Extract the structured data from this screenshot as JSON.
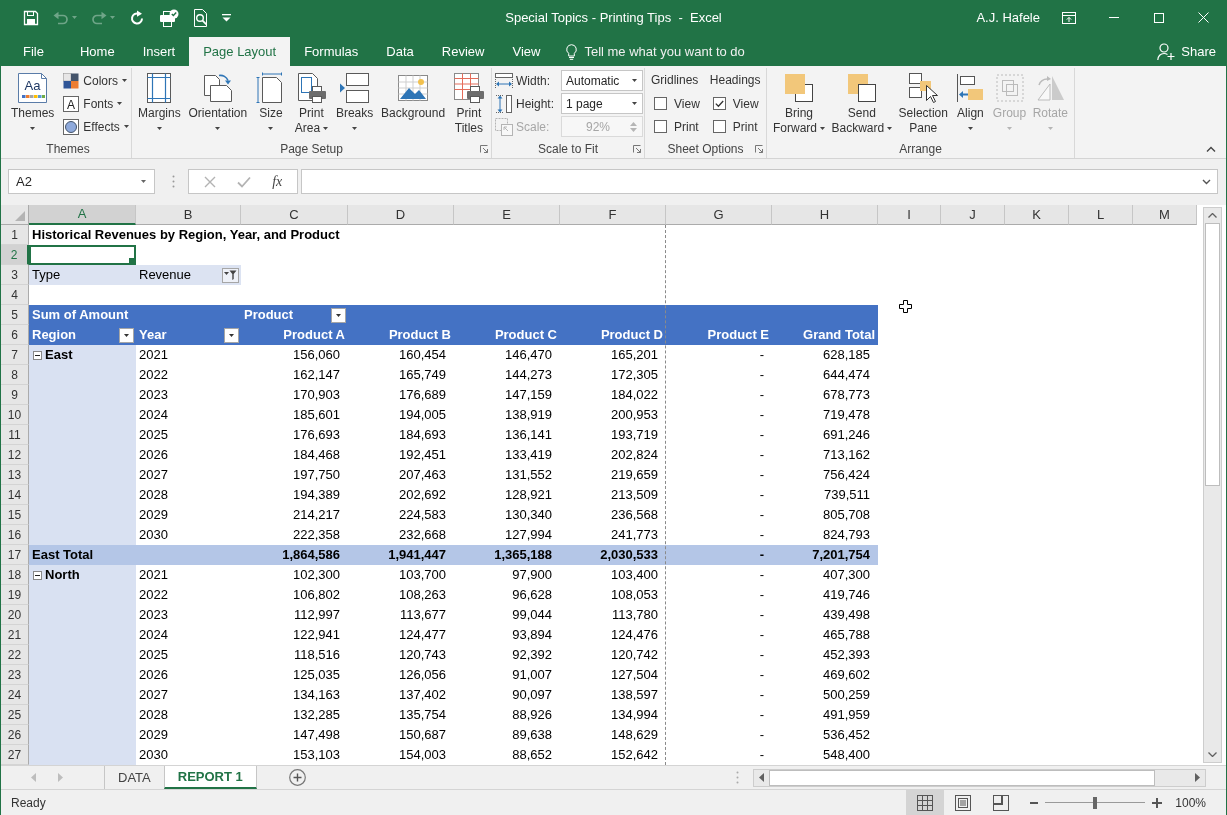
{
  "window": {
    "title": "Special Topics - Printing Tips  -  Excel",
    "user": "A.J. Hafele"
  },
  "quick_access": [
    {
      "disabled": false
    },
    {
      "disabled": true
    },
    {
      "disabled": true
    },
    {
      "disabled": false
    },
    {
      "disabled": false
    },
    {
      "disabled": false
    },
    {
      "disabled": false
    }
  ],
  "ribbon_tabs": [
    {
      "label": "File",
      "selected": false
    },
    {
      "label": "Home",
      "selected": false
    },
    {
      "label": "Insert",
      "selected": false
    },
    {
      "label": "Page Layout",
      "selected": true
    },
    {
      "label": "Formulas",
      "selected": false
    },
    {
      "label": "Data",
      "selected": false
    },
    {
      "label": "Review",
      "selected": false
    },
    {
      "label": "View",
      "selected": false
    }
  ],
  "tell_me": "Tell me what you want to do",
  "share": "Share",
  "ribbon_groups": [
    {
      "label": "Themes",
      "launcher": false,
      "items": [
        {
          "kind": "large",
          "label": "Themes",
          "glyph": "Aa",
          "dropdown": true
        },
        {
          "kind": "small",
          "label": "Colors",
          "dropdown": true
        },
        {
          "kind": "small",
          "label": "Fonts",
          "glyph": "A",
          "dropdown": true
        },
        {
          "kind": "small",
          "label": "Effects",
          "dropdown": true
        }
      ]
    },
    {
      "label": "Page Setup",
      "launcher": true,
      "items": [
        {
          "kind": "large",
          "label": "Margins",
          "dropdown": true
        },
        {
          "kind": "large",
          "label": "Orientation",
          "dropdown": true
        },
        {
          "kind": "large",
          "label": "Size",
          "dropdown": true
        },
        {
          "kind": "large",
          "label": "Print Area",
          "dropdown": true
        },
        {
          "kind": "large",
          "label": "Breaks",
          "dropdown": true
        },
        {
          "kind": "large",
          "label": "Background",
          "dropdown": false
        },
        {
          "kind": "large",
          "label": "Print Titles",
          "dropdown": false
        }
      ]
    },
    {
      "label": "Scale to Fit",
      "launcher": true,
      "items": [
        {
          "kind": "field",
          "label": "Width:",
          "value": "Automatic",
          "disabled": false
        },
        {
          "kind": "field",
          "label": "Height:",
          "value": "1 page",
          "disabled": false
        },
        {
          "kind": "spinner",
          "label": "Scale:",
          "value": "92%",
          "disabled": true
        }
      ]
    },
    {
      "label": "Sheet Options",
      "launcher": true,
      "items": [
        {
          "kind": "checks",
          "label": "Gridlines",
          "options": [
            {
              "label": "View",
              "checked": false
            },
            {
              "label": "Print",
              "checked": false
            }
          ]
        },
        {
          "kind": "checks",
          "label": "Headings",
          "options": [
            {
              "label": "View",
              "checked": true
            },
            {
              "label": "Print",
              "checked": false
            }
          ]
        }
      ]
    },
    {
      "label": "Arrange",
      "launcher": false,
      "items": [
        {
          "kind": "large",
          "label": "Bring Forward",
          "dropdown": true,
          "disabled": false
        },
        {
          "kind": "large",
          "label": "Send Backward",
          "dropdown": true,
          "disabled": false
        },
        {
          "kind": "large",
          "label": "Selection Pane",
          "dropdown": false,
          "disabled": false
        },
        {
          "kind": "large",
          "label": "Align",
          "dropdown": true,
          "disabled": false
        },
        {
          "kind": "large",
          "label": "Group",
          "dropdown": true,
          "disabled": true
        },
        {
          "kind": "large",
          "label": "Rotate",
          "dropdown": true,
          "disabled": true
        }
      ]
    }
  ],
  "formula_bar": {
    "name_box": "A2",
    "function_label": "fx"
  },
  "sheet": {
    "columns": [
      {
        "label": "A",
        "selected": true,
        "page_break_after": false
      },
      {
        "label": "B",
        "selected": false,
        "page_break_after": false
      },
      {
        "label": "C",
        "selected": false,
        "page_break_after": false
      },
      {
        "label": "D",
        "selected": false,
        "page_break_after": false
      },
      {
        "label": "E",
        "selected": false,
        "page_break_after": false
      },
      {
        "label": "F",
        "selected": false,
        "page_break_after": true
      },
      {
        "label": "G",
        "selected": false,
        "page_break_after": false
      },
      {
        "label": "H",
        "selected": false,
        "page_break_after": false
      },
      {
        "label": "I",
        "selected": false,
        "page_break_after": false
      },
      {
        "label": "J",
        "selected": false,
        "page_break_after": false
      },
      {
        "label": "K",
        "selected": false,
        "page_break_after": false
      },
      {
        "label": "L",
        "selected": false,
        "page_break_after": false
      },
      {
        "label": "M",
        "selected": false,
        "page_break_after": false
      }
    ],
    "rows": [
      {
        "label": "1",
        "selected": false
      },
      {
        "label": "2",
        "selected": true
      },
      {
        "label": "3",
        "selected": false
      },
      {
        "label": "4",
        "selected": false
      },
      {
        "label": "5",
        "selected": false
      },
      {
        "label": "6",
        "selected": false
      },
      {
        "label": "7",
        "selected": false
      },
      {
        "label": "8",
        "selected": false
      },
      {
        "label": "9",
        "selected": false
      },
      {
        "label": "10",
        "selected": false
      },
      {
        "label": "11",
        "selected": false
      },
      {
        "label": "12",
        "selected": false
      },
      {
        "label": "13",
        "selected": false
      },
      {
        "label": "14",
        "selected": false
      },
      {
        "label": "15",
        "selected": false
      },
      {
        "label": "16",
        "selected": false
      },
      {
        "label": "17",
        "selected": false
      },
      {
        "label": "18",
        "selected": false
      },
      {
        "label": "19",
        "selected": false
      },
      {
        "label": "20",
        "selected": false
      },
      {
        "label": "21",
        "selected": false
      },
      {
        "label": "22",
        "selected": false
      },
      {
        "label": "23",
        "selected": false
      },
      {
        "label": "24",
        "selected": false
      },
      {
        "label": "25",
        "selected": false
      },
      {
        "label": "26",
        "selected": false
      },
      {
        "label": "27",
        "selected": false
      }
    ],
    "title": "Historical Revenues by Region, Year, and Product",
    "report_filter": {
      "field": "Type",
      "value": "Revenue"
    },
    "pivot": {
      "corner": "Sum of Amount",
      "column_field": "Product",
      "row_fields": [
        "Region",
        "Year"
      ],
      "value_columns": [
        "Product A",
        "Product B",
        "Product C",
        "Product D",
        "Product E",
        "Grand Total"
      ],
      "groups": [
        {
          "region": "East",
          "expanded": true,
          "rows": [
            {
              "year": "2021",
              "values": [
                "156,060",
                "160,454",
                "146,470",
                "165,201",
                "-",
                "628,185"
              ]
            },
            {
              "year": "2022",
              "values": [
                "162,147",
                "165,749",
                "144,273",
                "172,305",
                "-",
                "644,474"
              ]
            },
            {
              "year": "2023",
              "values": [
                "170,903",
                "176,689",
                "147,159",
                "184,022",
                "-",
                "678,773"
              ]
            },
            {
              "year": "2024",
              "values": [
                "185,601",
                "194,005",
                "138,919",
                "200,953",
                "-",
                "719,478"
              ]
            },
            {
              "year": "2025",
              "values": [
                "176,693",
                "184,693",
                "136,141",
                "193,719",
                "-",
                "691,246"
              ]
            },
            {
              "year": "2026",
              "values": [
                "184,468",
                "192,451",
                "133,419",
                "202,824",
                "-",
                "713,162"
              ]
            },
            {
              "year": "2027",
              "values": [
                "197,750",
                "207,463",
                "131,552",
                "219,659",
                "-",
                "756,424"
              ]
            },
            {
              "year": "2028",
              "values": [
                "194,389",
                "202,692",
                "128,921",
                "213,509",
                "-",
                "739,511"
              ]
            },
            {
              "year": "2029",
              "values": [
                "214,217",
                "224,583",
                "130,340",
                "236,568",
                "-",
                "805,708"
              ]
            },
            {
              "year": "2030",
              "values": [
                "222,358",
                "232,668",
                "127,994",
                "241,773",
                "-",
                "824,793"
              ]
            }
          ],
          "total": {
            "label": "East Total",
            "values": [
              "1,864,586",
              "1,941,447",
              "1,365,188",
              "2,030,533",
              "-",
              "7,201,754"
            ]
          }
        },
        {
          "region": "North",
          "expanded": true,
          "rows": [
            {
              "year": "2021",
              "values": [
                "102,300",
                "103,700",
                "97,900",
                "103,400",
                "-",
                "407,300"
              ]
            },
            {
              "year": "2022",
              "values": [
                "106,802",
                "108,263",
                "96,628",
                "108,053",
                "-",
                "419,746"
              ]
            },
            {
              "year": "2023",
              "values": [
                "112,997",
                "113,677",
                "99,044",
                "113,780",
                "-",
                "439,498"
              ]
            },
            {
              "year": "2024",
              "values": [
                "122,941",
                "124,477",
                "93,894",
                "124,476",
                "-",
                "465,788"
              ]
            },
            {
              "year": "2025",
              "values": [
                "118,516",
                "120,743",
                "92,392",
                "120,742",
                "-",
                "452,393"
              ]
            },
            {
              "year": "2026",
              "values": [
                "125,035",
                "126,056",
                "91,007",
                "127,504",
                "-",
                "469,602"
              ]
            },
            {
              "year": "2027",
              "values": [
                "134,163",
                "137,402",
                "90,097",
                "138,597",
                "-",
                "500,259"
              ]
            },
            {
              "year": "2028",
              "values": [
                "132,285",
                "135,754",
                "88,926",
                "134,994",
                "-",
                "491,959"
              ]
            },
            {
              "year": "2029",
              "values": [
                "147,498",
                "150,687",
                "89,638",
                "148,629",
                "-",
                "536,452"
              ]
            },
            {
              "year": "2030",
              "values": [
                "153,103",
                "154,003",
                "88,652",
                "152,642",
                "-",
                "548,400"
              ]
            }
          ]
        }
      ]
    }
  },
  "sheet_tabs": [
    {
      "label": "DATA",
      "selected": false
    },
    {
      "label": "REPORT 1",
      "selected": true
    }
  ],
  "status_bar": {
    "status": "Ready",
    "views": [
      {
        "selected": true
      },
      {
        "selected": false
      },
      {
        "selected": false
      }
    ],
    "zoom": {
      "level": 0.5,
      "reading": "100%"
    }
  }
}
